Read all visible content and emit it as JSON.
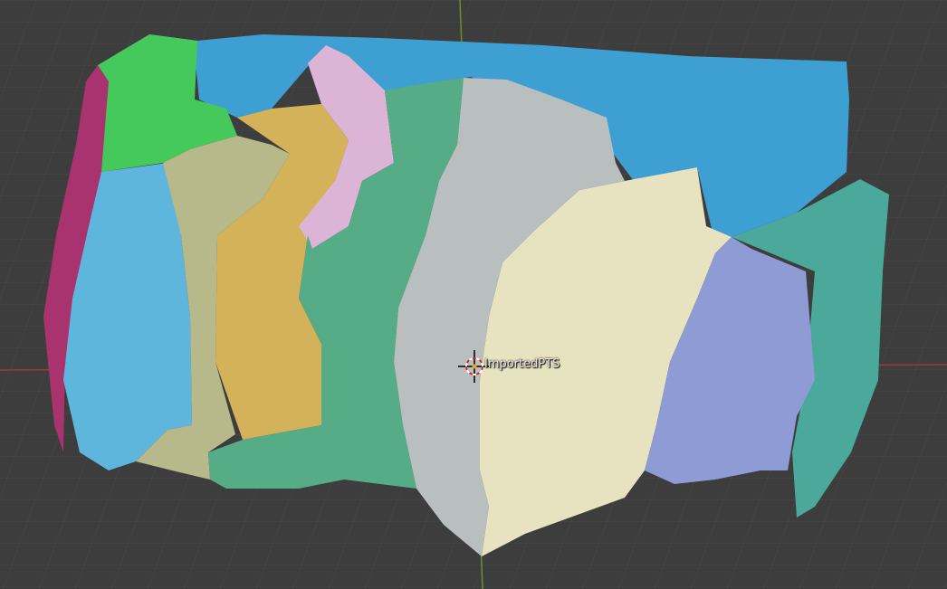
{
  "viewport": {
    "object_label": "ImportedPTS",
    "background_color": "#3d3d3d",
    "grid_color": "#4a4a4a",
    "axis_x_color": "#9b3a3a",
    "axis_y_color": "#6f8f2a"
  },
  "mesh_segments": [
    {
      "name": "magenta-segment",
      "color": "#a8336f"
    },
    {
      "name": "sky-blue-segment",
      "color": "#5fb6dc"
    },
    {
      "name": "green-segment",
      "color": "#45c95a"
    },
    {
      "name": "blue-top-segment",
      "color": "#3e9fd3"
    },
    {
      "name": "khaki-segment",
      "color": "#b8b98a"
    },
    {
      "name": "mustard-segment",
      "color": "#d4b25a"
    },
    {
      "name": "pink-segment",
      "color": "#dcb4d6"
    },
    {
      "name": "sea-green-segment",
      "color": "#55ac86"
    },
    {
      "name": "grey-segment",
      "color": "#b9bebf"
    },
    {
      "name": "cream-segment",
      "color": "#e7e2bf"
    },
    {
      "name": "periwinkle-segment",
      "color": "#8e9bd4"
    },
    {
      "name": "teal-segment",
      "color": "#4aa99a"
    }
  ]
}
